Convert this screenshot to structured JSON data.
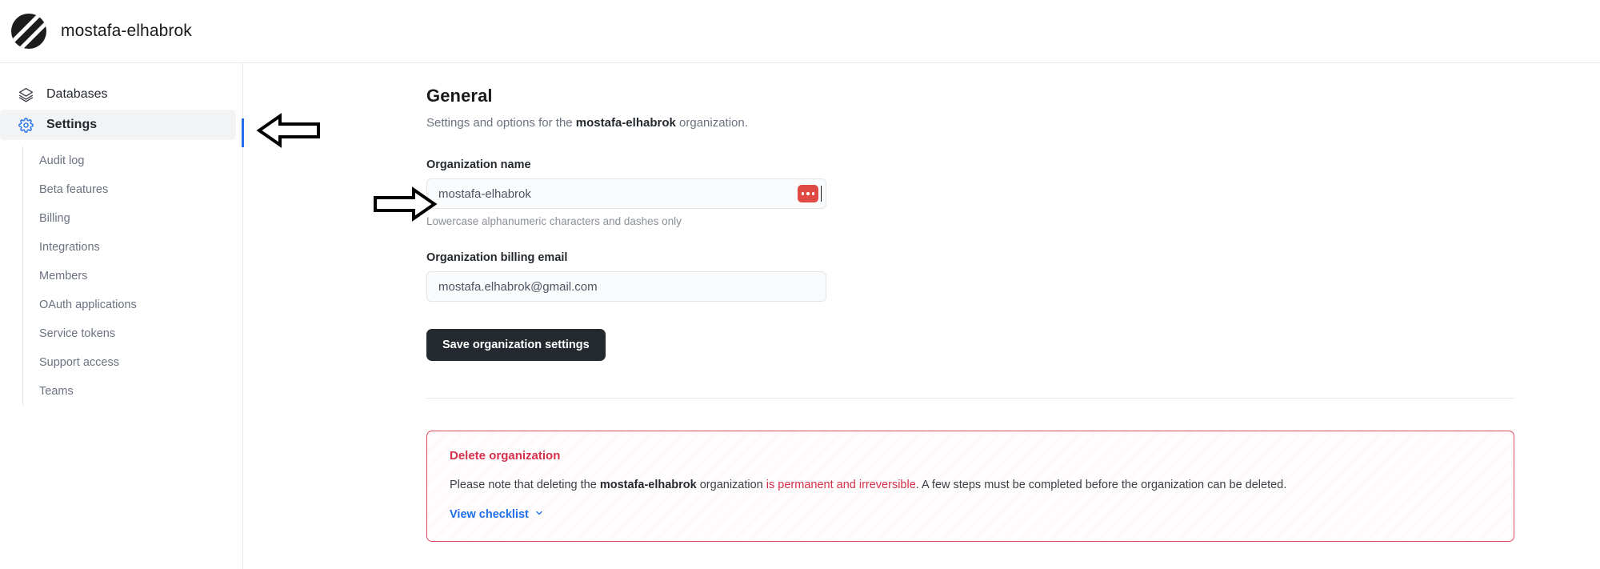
{
  "topbar": {
    "logo_icon": "organization-logo-icon",
    "org_name": "mostafa-elhabrok"
  },
  "sidebar": {
    "primary": [
      {
        "label": "Databases",
        "icon": "stacked-layers-icon",
        "active": false
      },
      {
        "label": "Settings",
        "icon": "gear-icon",
        "active": true
      }
    ],
    "sub_items": [
      {
        "label": "Audit log"
      },
      {
        "label": "Beta features"
      },
      {
        "label": "Billing"
      },
      {
        "label": "Integrations"
      },
      {
        "label": "Members"
      },
      {
        "label": "OAuth applications"
      },
      {
        "label": "Service tokens"
      },
      {
        "label": "Support access"
      },
      {
        "label": "Teams"
      }
    ],
    "active_indicator_color": "#1f6feb"
  },
  "main": {
    "title": "General",
    "description_prefix": "Settings and options for the ",
    "description_org": "mostafa-elhabrok",
    "description_suffix": " organization.",
    "org_name_field": {
      "label": "Organization name",
      "value": "mostafa-elhabrok",
      "placeholder": "Organization name",
      "hint": "Lowercase alphanumeric characters and dashes only",
      "badge_icon": "ellipsis-badge-icon",
      "badge_color": "#e04a44"
    },
    "billing_email_field": {
      "label": "Organization billing email",
      "value": "mostafa.elhabrok@gmail.com",
      "placeholder": "Organization billing email"
    },
    "save_button": "Save organization settings",
    "danger_zone": {
      "title": "Delete organization",
      "text_part1": "Please note that deleting the ",
      "text_org": "mostafa-elhabrok",
      "text_part2": " organization ",
      "text_warning": "is permanent and irreversible",
      "text_part3": ". A few steps must be completed before the organization can be deleted.",
      "link_label": "View checklist",
      "link_icon": "chevron-down-icon",
      "border_color": "#e0485e",
      "accent_color": "#d6304b"
    }
  },
  "annotations": [
    {
      "name": "arrow-pointing-to-settings",
      "direction": "left"
    },
    {
      "name": "arrow-pointing-to-org-name-input",
      "direction": "right"
    }
  ]
}
